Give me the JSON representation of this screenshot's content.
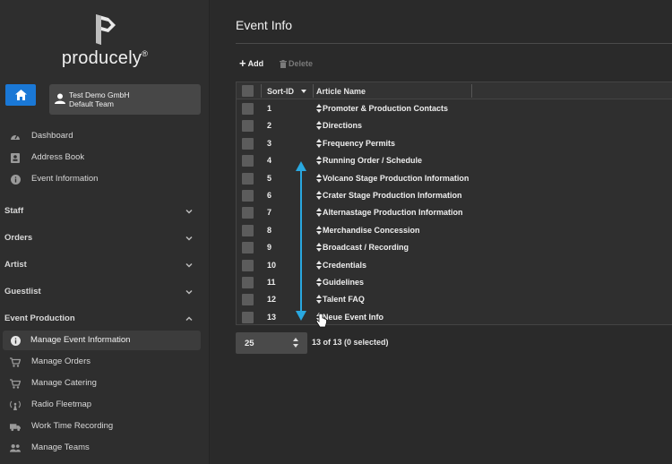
{
  "brand": {
    "name": "producely",
    "trademark": "®"
  },
  "team": {
    "company": "Test Demo GmbH",
    "team_name": "Default Team"
  },
  "nav": {
    "top_items": [
      {
        "label": "Dashboard",
        "icon": "dashboard-gauge-icon"
      },
      {
        "label": "Address Book",
        "icon": "address-book-icon"
      },
      {
        "label": "Event Information",
        "icon": "info-circle-icon"
      }
    ],
    "sections": [
      {
        "label": "Staff",
        "expanded": false
      },
      {
        "label": "Orders",
        "expanded": false
      },
      {
        "label": "Artist",
        "expanded": false
      },
      {
        "label": "Guestlist",
        "expanded": false
      },
      {
        "label": "Event Production",
        "expanded": true
      }
    ],
    "event_production_items": [
      {
        "label": "Manage Event Information",
        "icon": "info-circle-icon",
        "active": true
      },
      {
        "label": "Manage Orders",
        "icon": "cart-icon"
      },
      {
        "label": "Manage Catering",
        "icon": "cart-icon"
      },
      {
        "label": "Radio Fleetmap",
        "icon": "radio-antenna-icon"
      },
      {
        "label": "Work Time Recording",
        "icon": "truck-clock-icon"
      },
      {
        "label": "Manage Teams",
        "icon": "users-icon"
      }
    ]
  },
  "page": {
    "title": "Event Info"
  },
  "toolbar": {
    "add_label": "Add",
    "delete_label": "Delete"
  },
  "grid": {
    "columns": [
      "Sort-ID",
      "Article Name"
    ],
    "rows": [
      {
        "id": "1",
        "name": "Promoter & Production Contacts"
      },
      {
        "id": "2",
        "name": "Directions"
      },
      {
        "id": "3",
        "name": "Frequency Permits"
      },
      {
        "id": "4",
        "name": "Running Order / Schedule"
      },
      {
        "id": "5",
        "name": "Volcano Stage Production Information"
      },
      {
        "id": "6",
        "name": "Crater Stage Production Information"
      },
      {
        "id": "7",
        "name": "Alternastage Production Information"
      },
      {
        "id": "8",
        "name": "Merchandise Concession"
      },
      {
        "id": "9",
        "name": "Broadcast / Recording"
      },
      {
        "id": "10",
        "name": "Credentials"
      },
      {
        "id": "11",
        "name": "Guidelines"
      },
      {
        "id": "12",
        "name": "Talent FAQ"
      },
      {
        "id": "13",
        "name": "Neue Event Info"
      }
    ]
  },
  "pagination": {
    "page_size": "25",
    "summary": "13 of 13 (0 selected)"
  },
  "colors": {
    "accent": "#1a78d6",
    "annotation": "#29a8e0"
  }
}
